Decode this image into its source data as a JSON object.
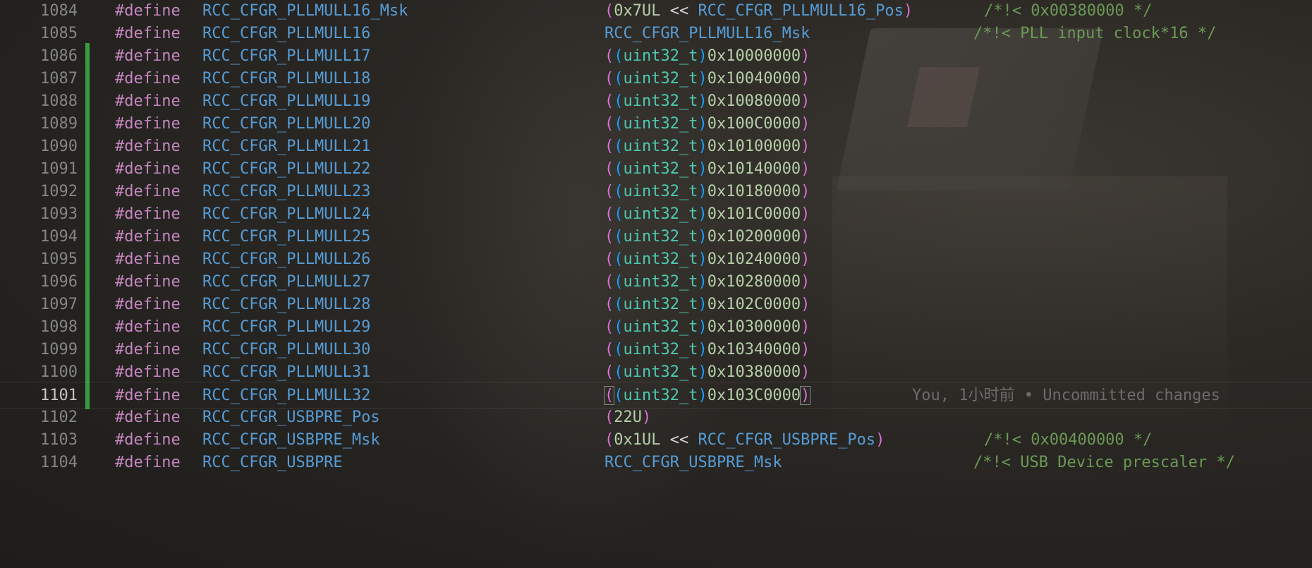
{
  "editor": {
    "blame_text": "You, 1小时前 • Uncommitted changes",
    "lines": [
      {
        "num": "1084",
        "kw": "#define",
        "name": "RCC_CFGR_PLLMULL16_Msk",
        "val_kind": "shift",
        "shift": {
          "open": "(",
          "lit": "0x7UL",
          "op": " << ",
          "macro": "RCC_CFGR_PLLMULL16_Pos",
          "close": ")"
        },
        "comment": "/*!< 0x00380000 */"
      },
      {
        "num": "1085",
        "kw": "#define",
        "name": "RCC_CFGR_PLLMULL16",
        "val_kind": "macro",
        "macro": "RCC_CFGR_PLLMULL16_Msk",
        "comment": "/*!< PLL input clock*16 */"
      },
      {
        "num": "1086",
        "kw": "#define",
        "name": "RCC_CFGR_PLLMULL17",
        "val_kind": "cast",
        "type": "uint32_t",
        "hex": "0x10000000",
        "changed": true
      },
      {
        "num": "1087",
        "kw": "#define",
        "name": "RCC_CFGR_PLLMULL18",
        "val_kind": "cast",
        "type": "uint32_t",
        "hex": "0x10040000",
        "changed": true
      },
      {
        "num": "1088",
        "kw": "#define",
        "name": "RCC_CFGR_PLLMULL19",
        "val_kind": "cast",
        "type": "uint32_t",
        "hex": "0x10080000",
        "changed": true
      },
      {
        "num": "1089",
        "kw": "#define",
        "name": "RCC_CFGR_PLLMULL20",
        "val_kind": "cast",
        "type": "uint32_t",
        "hex": "0x100C0000",
        "changed": true
      },
      {
        "num": "1090",
        "kw": "#define",
        "name": "RCC_CFGR_PLLMULL21",
        "val_kind": "cast",
        "type": "uint32_t",
        "hex": "0x10100000",
        "changed": true
      },
      {
        "num": "1091",
        "kw": "#define",
        "name": "RCC_CFGR_PLLMULL22",
        "val_kind": "cast",
        "type": "uint32_t",
        "hex": "0x10140000",
        "changed": true
      },
      {
        "num": "1092",
        "kw": "#define",
        "name": "RCC_CFGR_PLLMULL23",
        "val_kind": "cast",
        "type": "uint32_t",
        "hex": "0x10180000",
        "changed": true
      },
      {
        "num": "1093",
        "kw": "#define",
        "name": "RCC_CFGR_PLLMULL24",
        "val_kind": "cast",
        "type": "uint32_t",
        "hex": "0x101C0000",
        "changed": true
      },
      {
        "num": "1094",
        "kw": "#define",
        "name": "RCC_CFGR_PLLMULL25",
        "val_kind": "cast",
        "type": "uint32_t",
        "hex": "0x10200000",
        "changed": true
      },
      {
        "num": "1095",
        "kw": "#define",
        "name": "RCC_CFGR_PLLMULL26",
        "val_kind": "cast",
        "type": "uint32_t",
        "hex": "0x10240000",
        "changed": true
      },
      {
        "num": "1096",
        "kw": "#define",
        "name": "RCC_CFGR_PLLMULL27",
        "val_kind": "cast",
        "type": "uint32_t",
        "hex": "0x10280000",
        "changed": true
      },
      {
        "num": "1097",
        "kw": "#define",
        "name": "RCC_CFGR_PLLMULL28",
        "val_kind": "cast",
        "type": "uint32_t",
        "hex": "0x102C0000",
        "changed": true
      },
      {
        "num": "1098",
        "kw": "#define",
        "name": "RCC_CFGR_PLLMULL29",
        "val_kind": "cast",
        "type": "uint32_t",
        "hex": "0x10300000",
        "changed": true
      },
      {
        "num": "1099",
        "kw": "#define",
        "name": "RCC_CFGR_PLLMULL30",
        "val_kind": "cast",
        "type": "uint32_t",
        "hex": "0x10340000",
        "changed": true
      },
      {
        "num": "1100",
        "kw": "#define",
        "name": "RCC_CFGR_PLLMULL31",
        "val_kind": "cast",
        "type": "uint32_t",
        "hex": "0x10380000",
        "changed": true
      },
      {
        "num": "1101",
        "kw": "#define",
        "name": "RCC_CFGR_PLLMULL32",
        "val_kind": "cast",
        "type": "uint32_t",
        "hex": "0x103C0000",
        "changed": true,
        "current": true
      },
      {
        "num": "1102",
        "kw": "#define",
        "name": "RCC_CFGR_USBPRE_Pos",
        "val_kind": "paren_num",
        "num_val": "22U"
      },
      {
        "num": "1103",
        "kw": "#define",
        "name": "RCC_CFGR_USBPRE_Msk",
        "val_kind": "shift",
        "shift": {
          "open": "(",
          "lit": "0x1UL",
          "op": " << ",
          "macro": "RCC_CFGR_USBPRE_Pos",
          "close": ")"
        },
        "comment": "/*!< 0x00400000 */"
      },
      {
        "num": "1104",
        "kw": "#define",
        "name": "RCC_CFGR_USBPRE",
        "val_kind": "macro",
        "macro": "RCC_CFGR_USBPRE_Msk",
        "comment": "/*!< USB Device prescaler */"
      }
    ]
  },
  "colors": {
    "keyword": "#c586c0",
    "identifier": "#569cd6",
    "type": "#4ec9b0",
    "number": "#b5cea8",
    "comment": "#6a9955",
    "git_added": "#3a9a44"
  }
}
